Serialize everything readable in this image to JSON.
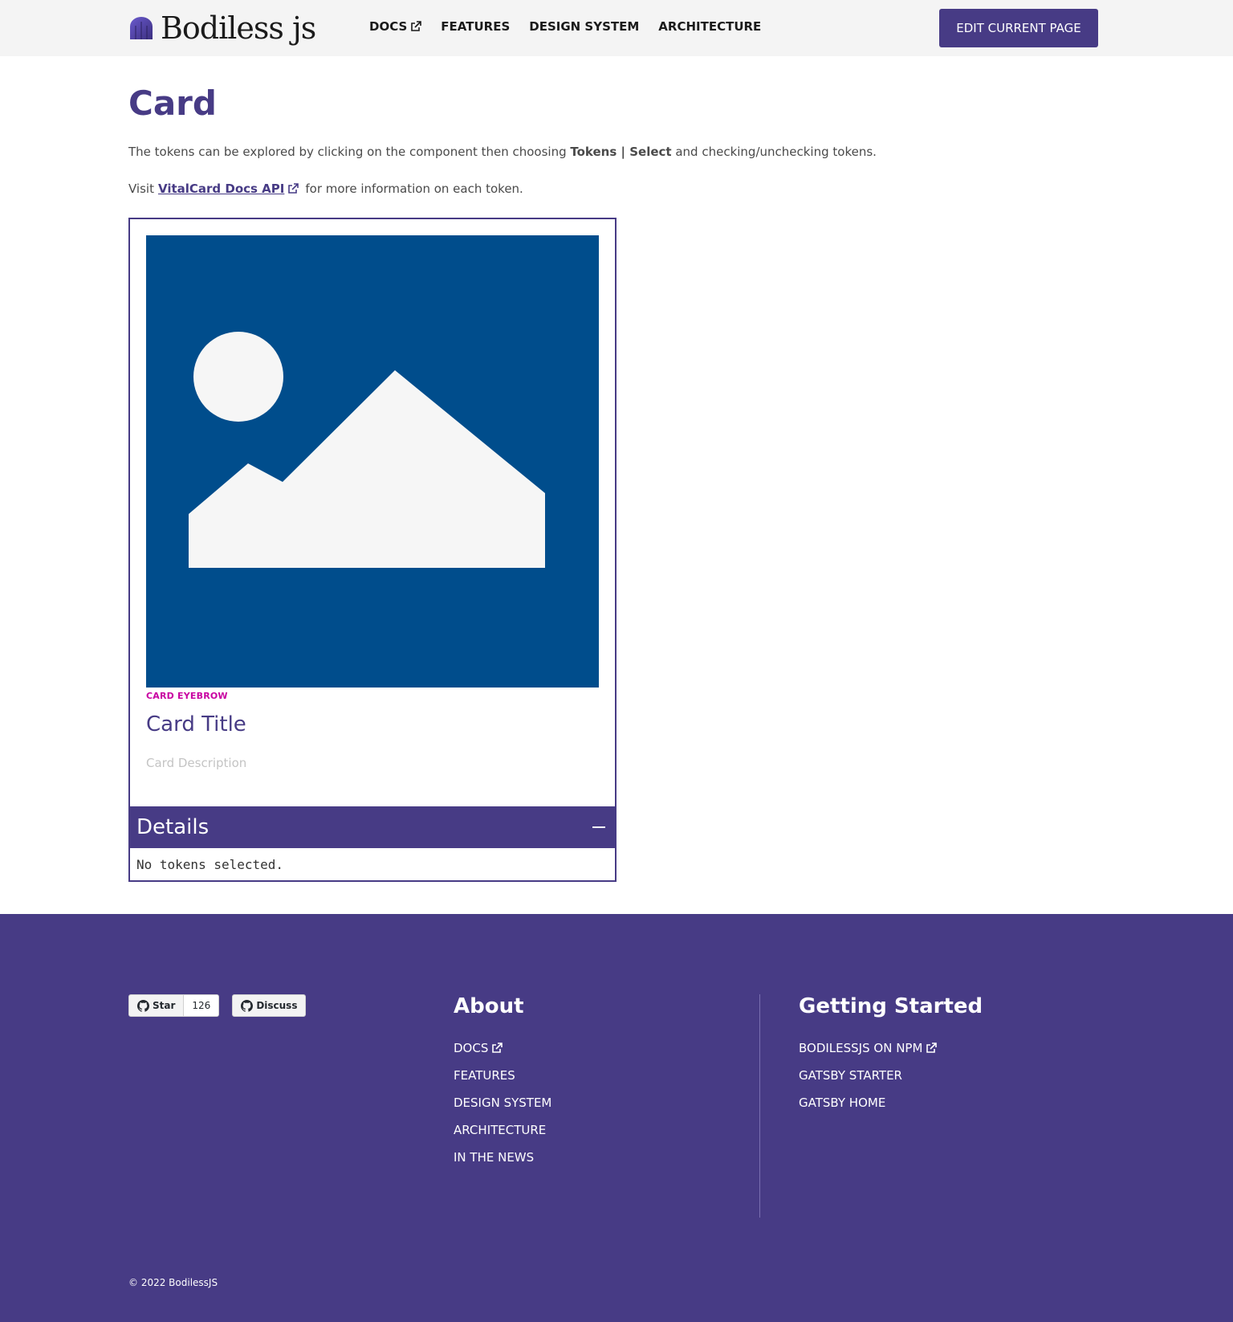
{
  "header": {
    "logo_text": "Bodiless js",
    "nav": [
      {
        "label": "DOCS",
        "external": true
      },
      {
        "label": "FEATURES",
        "external": false
      },
      {
        "label": "DESIGN SYSTEM",
        "external": false
      },
      {
        "label": "ARCHITECTURE",
        "external": false
      }
    ],
    "edit_button": "EDIT CURRENT PAGE"
  },
  "main": {
    "title": "Card",
    "intro_before": "The tokens can be explored by clicking on the component then choosing ",
    "intro_bold": "Tokens | Select",
    "intro_after": " and checking/unchecking tokens.",
    "visit_prefix": "Visit",
    "visit_link": "VitalCard Docs API",
    "visit_suffix": "for more information on each token."
  },
  "card": {
    "eyebrow": "CARD EYEBROW",
    "title": "Card Title",
    "description": "Card Description",
    "image_icon": "image-placeholder-icon",
    "image_bg": "#004d8c",
    "image_fg": "#f6f6f6"
  },
  "details": {
    "title": "Details",
    "tokens_text": "No tokens selected."
  },
  "footer": {
    "github": {
      "star_label": "Star",
      "star_count": "126",
      "discuss_label": "Discuss"
    },
    "about": {
      "heading": "About",
      "links": [
        {
          "label": "DOCS",
          "external": true
        },
        {
          "label": "FEATURES",
          "external": false
        },
        {
          "label": "DESIGN SYSTEM",
          "external": false
        },
        {
          "label": "ARCHITECTURE",
          "external": false
        },
        {
          "label": "IN THE NEWS",
          "external": false
        }
      ]
    },
    "getting_started": {
      "heading": "Getting Started",
      "links": [
        {
          "label": "BODILESSJS ON NPM",
          "external": true
        },
        {
          "label": "GATSBY STARTER",
          "external": false
        },
        {
          "label": "GATSBY HOME",
          "external": false
        }
      ]
    },
    "copyright": "©  2022 BodilessJS"
  },
  "colors": {
    "brand": "#473b85",
    "eyebrow": "#c800a1",
    "header_bg": "#f4f4f4"
  }
}
